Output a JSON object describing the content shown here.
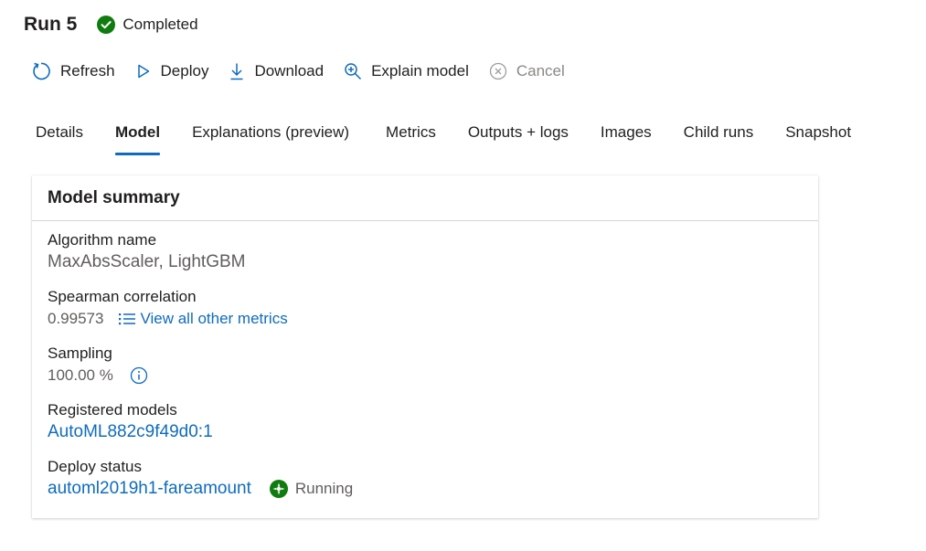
{
  "header": {
    "run_title": "Run 5",
    "status": "Completed"
  },
  "toolbar": {
    "refresh": "Refresh",
    "deploy": "Deploy",
    "download": "Download",
    "explain": "Explain model",
    "cancel": "Cancel"
  },
  "tabs": [
    {
      "label": "Details"
    },
    {
      "label": "Model"
    },
    {
      "label": "Explanations (preview)"
    },
    {
      "label": "Metrics"
    },
    {
      "label": "Outputs + logs"
    },
    {
      "label": "Images"
    },
    {
      "label": "Child runs"
    },
    {
      "label": "Snapshot"
    }
  ],
  "active_tab": "Model",
  "summary": {
    "title": "Model summary",
    "algorithm_label": "Algorithm name",
    "algorithm_value": "MaxAbsScaler, LightGBM",
    "spearman_label": "Spearman correlation",
    "spearman_value": "0.99573",
    "metrics_link": "View all other metrics",
    "sampling_label": "Sampling",
    "sampling_value": "100.00 %",
    "registered_label": "Registered models",
    "registered_value": "AutoML882c9f49d0:1",
    "deploy_label": "Deploy status",
    "deploy_value": "automl2019h1-fareamount",
    "deploy_state": "Running"
  },
  "colors": {
    "accent": "#0f6cbd",
    "success": "#107c10",
    "disabled": "#8a8886"
  }
}
